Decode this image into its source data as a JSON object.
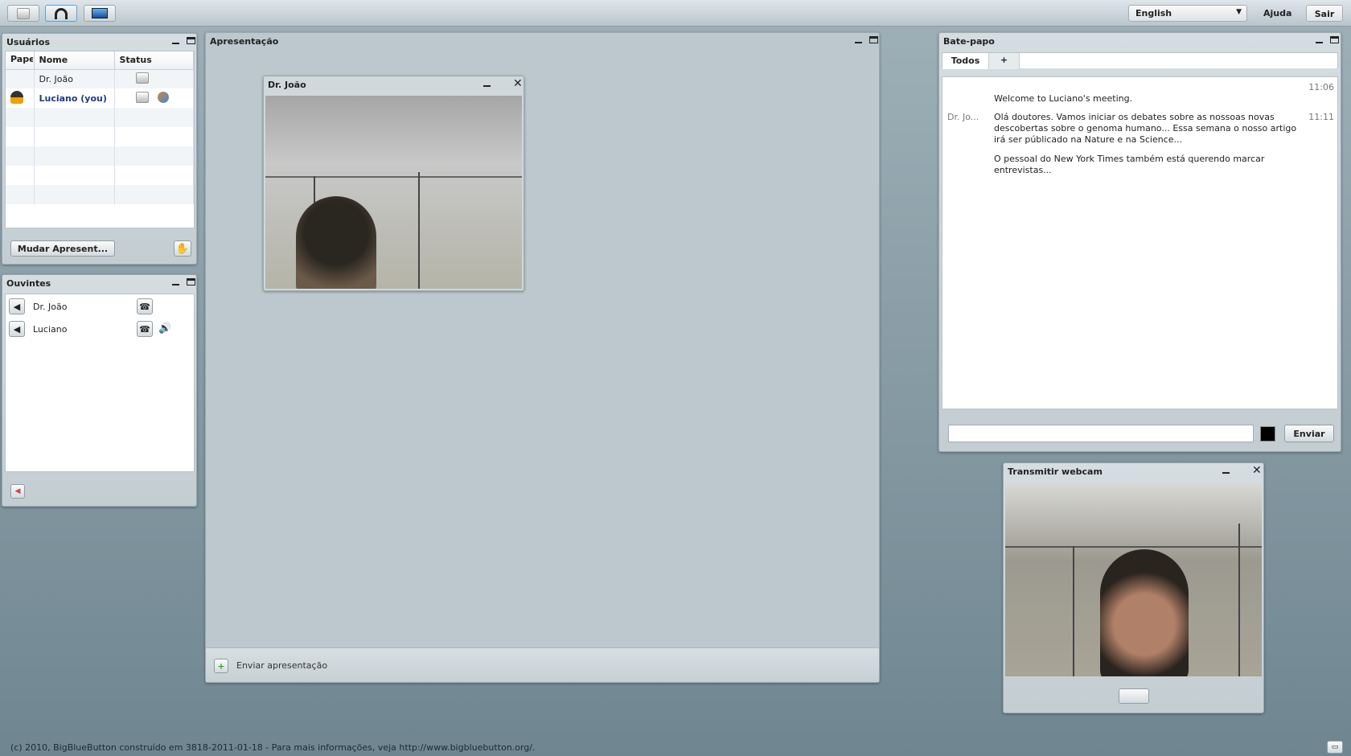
{
  "topbar": {
    "buttons": [
      {
        "icon": "webcam-icon"
      },
      {
        "icon": "headset-icon"
      },
      {
        "icon": "desktop-share-icon"
      }
    ],
    "language": "English",
    "help": "Ajuda",
    "logout": "Sair"
  },
  "users": {
    "title": "Usuários",
    "columns": [
      "Papel",
      "Nome",
      "Status"
    ],
    "rows": [
      {
        "role_icon": "",
        "name": "Dr. João",
        "status_icons": [
          "webcam-icon"
        ]
      },
      {
        "role_icon": "presenter-icon",
        "name": "Luciano (you)",
        "status_icons": [
          "webcam-icon",
          "presenter-status-icon"
        ],
        "highlight": "#1a3c8c"
      }
    ],
    "switch_presenter": "Mudar Apresent...",
    "raise_hand_icon": "raise-hand-icon"
  },
  "listeners": {
    "title": "Ouvintes",
    "rows": [
      {
        "name": "Dr. João",
        "talking": false
      },
      {
        "name": "Luciano",
        "talking": true
      }
    ]
  },
  "presentation": {
    "title": "Apresentação",
    "upload_label": "Enviar apresentação"
  },
  "video_window": {
    "title": "Dr. João"
  },
  "chat": {
    "title": "Bate-papo",
    "tabs": [
      "Todos",
      "+"
    ],
    "messages": [
      {
        "sender": "",
        "text": "Welcome to Luciano's meeting.",
        "time": "11:06"
      },
      {
        "sender": "Dr. Jo...",
        "text": "Olá doutores. Vamos iniciar os debates sobre as nossoas novas descobertas sobre o genoma humano... Essa semana o nosso artigo irá ser públicado na Nature e na Science...",
        "time": "11:11"
      },
      {
        "sender": "",
        "text": "O pessoal do New York Times também está querendo marcar entrevistas...",
        "time": ""
      }
    ],
    "input_value": "",
    "send": "Enviar",
    "text_color": "#000000"
  },
  "webcam": {
    "title": "Transmitir webcam"
  },
  "footer": "(c) 2010, BigBlueButton construído em 3818-2011-01-18 - Para mais informações, veja http://www.bigbluebutton.org/."
}
